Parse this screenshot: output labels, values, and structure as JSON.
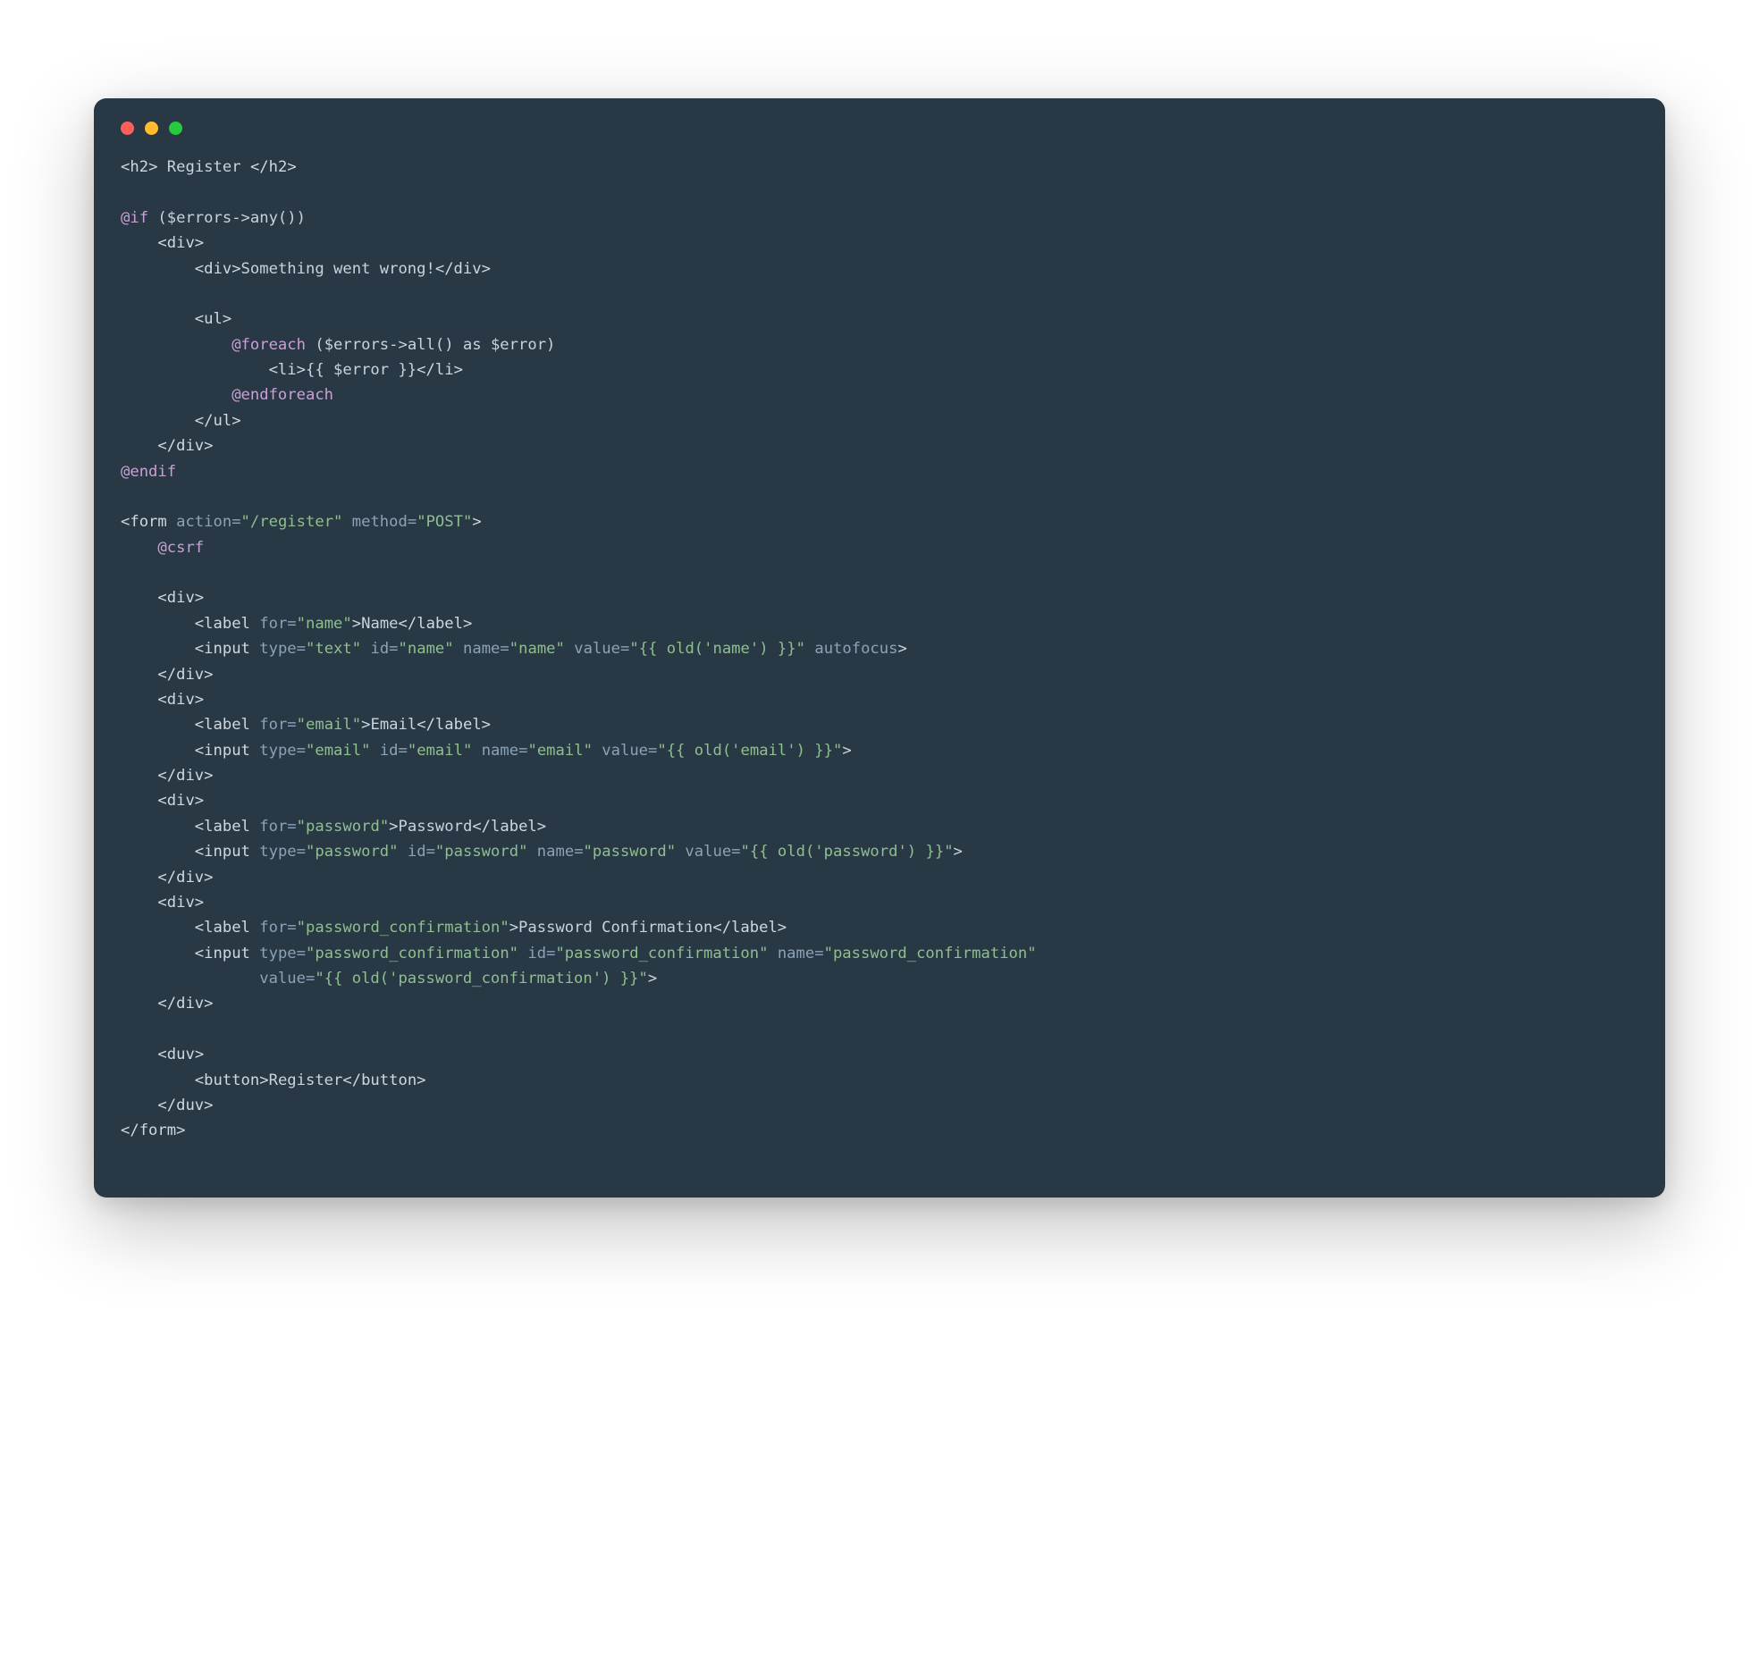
{
  "title_block": {
    "tag": "h2",
    "text": "Register"
  },
  "errors_block": {
    "if_expr": "($errors->any())",
    "header_text": "Something went wrong!",
    "foreach_expr": "($errors->all() as $error)",
    "item_expr": "{{ $error }}"
  },
  "form": {
    "action": "/register",
    "method": "POST",
    "csrf": "@csrf",
    "fields": [
      {
        "div": "name",
        "label_for": "name",
        "label_text": "Name",
        "input_type": "text",
        "input_id": "name",
        "input_name": "name",
        "input_value": "{{ old('name') }}",
        "extra": "autofocus"
      },
      {
        "div": "email",
        "label_for": "email",
        "label_text": "Email",
        "input_type": "email",
        "input_id": "email",
        "input_name": "email",
        "input_value": "{{ old('email') }}",
        "extra": ""
      },
      {
        "div": "password",
        "label_for": "password",
        "label_text": "Password",
        "input_type": "password",
        "input_id": "password",
        "input_name": "password",
        "input_value": "{{ old('password') }}",
        "extra": ""
      },
      {
        "div": "password_confirmation",
        "label_for": "password_confirmation",
        "label_text": "Password Confirmation",
        "input_type": "password_confirmation",
        "input_id": "password_confirmation",
        "input_name": "password_confirmation",
        "input_value": "{{ old('password_confirmation') }}",
        "extra": "",
        "wrap_value": true
      }
    ],
    "submit": {
      "wrapper": "duv",
      "text": "Register"
    }
  }
}
